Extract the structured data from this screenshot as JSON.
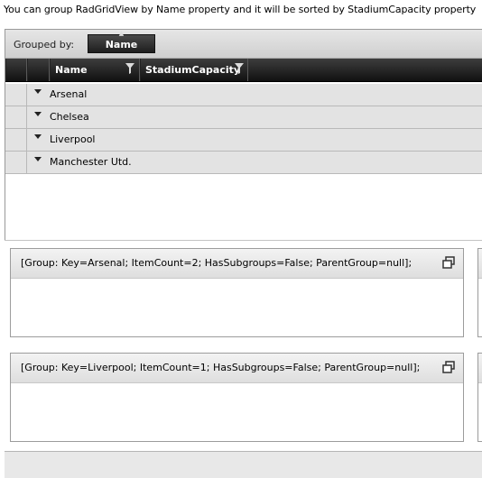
{
  "description_text": "You can group RadGridView by Name property and it will be sorted by StadiumCapacity property",
  "grid": {
    "grouped_by_label": "Grouped by:",
    "group_chip_label": "Name",
    "columns": [
      "Name",
      "StadiumCapacity"
    ],
    "groups": [
      "Arsenal",
      "Chelsea",
      "Liverpool",
      "Manchester Utd."
    ]
  },
  "cards": [
    {
      "title": "[Group: Key=Arsenal; ItemCount=2; HasSubgroups=False; ParentGroup=null];"
    },
    {
      "title": "[Group: Key=Liverpool; ItemCount=1; HasSubgroups=False; ParentGroup=null];"
    }
  ],
  "colors": {
    "header_dark": "#1e1e1e",
    "group_row_bg": "#e3e3e3",
    "panel_bg": "#d9d9d9"
  }
}
